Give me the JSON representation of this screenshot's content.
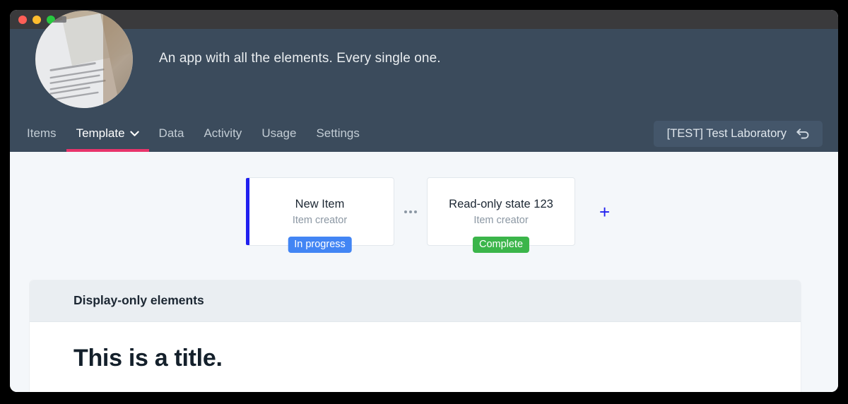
{
  "window": {
    "traffic_lights": [
      "close",
      "minimize",
      "zoom"
    ]
  },
  "header": {
    "title": "",
    "subtitle": "An app with all the elements. Every single one.",
    "avatar_icon": "document-photo-avatar",
    "nav": [
      {
        "label": "Items",
        "active": false,
        "has_chevron": false
      },
      {
        "label": "Template",
        "active": true,
        "has_chevron": true
      },
      {
        "label": "Data",
        "active": false,
        "has_chevron": false
      },
      {
        "label": "Activity",
        "active": false,
        "has_chevron": false
      },
      {
        "label": "Usage",
        "active": false,
        "has_chevron": false
      },
      {
        "label": "Settings",
        "active": false,
        "has_chevron": false
      }
    ],
    "lab_button": {
      "label": "[TEST] Test Laboratory",
      "icon": "undo-arrow-icon"
    }
  },
  "main": {
    "cards": [
      {
        "title": "New Item",
        "subtitle": "Item creator",
        "badge": "In progress",
        "badge_color": "#4285f4",
        "accent": true,
        "accent_color": "#2020ef"
      },
      {
        "title": "Read-only state 123",
        "subtitle": "Item creator",
        "badge": "Complete",
        "badge_color": "#3bb54a",
        "accent": false,
        "accent_color": ""
      }
    ],
    "separator_icon": "ellipsis-icon",
    "add_button_label": "+",
    "panel": {
      "header_title": "Display-only elements",
      "title": "This is a title."
    }
  },
  "colors": {
    "header_bg": "#3b4b5c",
    "active_tab_underline": "#e8346b",
    "page_bg": "#f4f7fa",
    "panel_header_bg": "#eaeef2",
    "accent_blue": "#2020ef"
  }
}
